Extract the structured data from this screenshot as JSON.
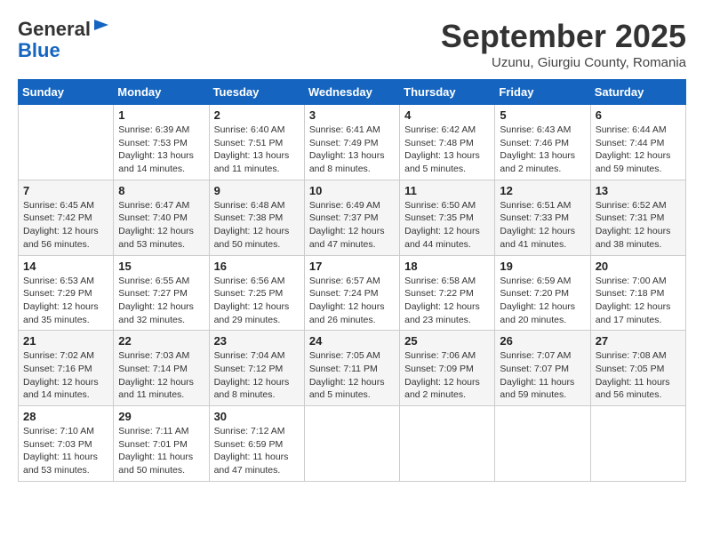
{
  "header": {
    "logo_line1": "General",
    "logo_line2": "Blue",
    "month_title": "September 2025",
    "subtitle": "Uzunu, Giurgiu County, Romania"
  },
  "weekdays": [
    "Sunday",
    "Monday",
    "Tuesday",
    "Wednesday",
    "Thursday",
    "Friday",
    "Saturday"
  ],
  "weeks": [
    [
      {
        "day": "",
        "sunrise": "",
        "sunset": "",
        "daylight": ""
      },
      {
        "day": "1",
        "sunrise": "Sunrise: 6:39 AM",
        "sunset": "Sunset: 7:53 PM",
        "daylight": "Daylight: 13 hours and 14 minutes."
      },
      {
        "day": "2",
        "sunrise": "Sunrise: 6:40 AM",
        "sunset": "Sunset: 7:51 PM",
        "daylight": "Daylight: 13 hours and 11 minutes."
      },
      {
        "day": "3",
        "sunrise": "Sunrise: 6:41 AM",
        "sunset": "Sunset: 7:49 PM",
        "daylight": "Daylight: 13 hours and 8 minutes."
      },
      {
        "day": "4",
        "sunrise": "Sunrise: 6:42 AM",
        "sunset": "Sunset: 7:48 PM",
        "daylight": "Daylight: 13 hours and 5 minutes."
      },
      {
        "day": "5",
        "sunrise": "Sunrise: 6:43 AM",
        "sunset": "Sunset: 7:46 PM",
        "daylight": "Daylight: 13 hours and 2 minutes."
      },
      {
        "day": "6",
        "sunrise": "Sunrise: 6:44 AM",
        "sunset": "Sunset: 7:44 PM",
        "daylight": "Daylight: 12 hours and 59 minutes."
      }
    ],
    [
      {
        "day": "7",
        "sunrise": "Sunrise: 6:45 AM",
        "sunset": "Sunset: 7:42 PM",
        "daylight": "Daylight: 12 hours and 56 minutes."
      },
      {
        "day": "8",
        "sunrise": "Sunrise: 6:47 AM",
        "sunset": "Sunset: 7:40 PM",
        "daylight": "Daylight: 12 hours and 53 minutes."
      },
      {
        "day": "9",
        "sunrise": "Sunrise: 6:48 AM",
        "sunset": "Sunset: 7:38 PM",
        "daylight": "Daylight: 12 hours and 50 minutes."
      },
      {
        "day": "10",
        "sunrise": "Sunrise: 6:49 AM",
        "sunset": "Sunset: 7:37 PM",
        "daylight": "Daylight: 12 hours and 47 minutes."
      },
      {
        "day": "11",
        "sunrise": "Sunrise: 6:50 AM",
        "sunset": "Sunset: 7:35 PM",
        "daylight": "Daylight: 12 hours and 44 minutes."
      },
      {
        "day": "12",
        "sunrise": "Sunrise: 6:51 AM",
        "sunset": "Sunset: 7:33 PM",
        "daylight": "Daylight: 12 hours and 41 minutes."
      },
      {
        "day": "13",
        "sunrise": "Sunrise: 6:52 AM",
        "sunset": "Sunset: 7:31 PM",
        "daylight": "Daylight: 12 hours and 38 minutes."
      }
    ],
    [
      {
        "day": "14",
        "sunrise": "Sunrise: 6:53 AM",
        "sunset": "Sunset: 7:29 PM",
        "daylight": "Daylight: 12 hours and 35 minutes."
      },
      {
        "day": "15",
        "sunrise": "Sunrise: 6:55 AM",
        "sunset": "Sunset: 7:27 PM",
        "daylight": "Daylight: 12 hours and 32 minutes."
      },
      {
        "day": "16",
        "sunrise": "Sunrise: 6:56 AM",
        "sunset": "Sunset: 7:25 PM",
        "daylight": "Daylight: 12 hours and 29 minutes."
      },
      {
        "day": "17",
        "sunrise": "Sunrise: 6:57 AM",
        "sunset": "Sunset: 7:24 PM",
        "daylight": "Daylight: 12 hours and 26 minutes."
      },
      {
        "day": "18",
        "sunrise": "Sunrise: 6:58 AM",
        "sunset": "Sunset: 7:22 PM",
        "daylight": "Daylight: 12 hours and 23 minutes."
      },
      {
        "day": "19",
        "sunrise": "Sunrise: 6:59 AM",
        "sunset": "Sunset: 7:20 PM",
        "daylight": "Daylight: 12 hours and 20 minutes."
      },
      {
        "day": "20",
        "sunrise": "Sunrise: 7:00 AM",
        "sunset": "Sunset: 7:18 PM",
        "daylight": "Daylight: 12 hours and 17 minutes."
      }
    ],
    [
      {
        "day": "21",
        "sunrise": "Sunrise: 7:02 AM",
        "sunset": "Sunset: 7:16 PM",
        "daylight": "Daylight: 12 hours and 14 minutes."
      },
      {
        "day": "22",
        "sunrise": "Sunrise: 7:03 AM",
        "sunset": "Sunset: 7:14 PM",
        "daylight": "Daylight: 12 hours and 11 minutes."
      },
      {
        "day": "23",
        "sunrise": "Sunrise: 7:04 AM",
        "sunset": "Sunset: 7:12 PM",
        "daylight": "Daylight: 12 hours and 8 minutes."
      },
      {
        "day": "24",
        "sunrise": "Sunrise: 7:05 AM",
        "sunset": "Sunset: 7:11 PM",
        "daylight": "Daylight: 12 hours and 5 minutes."
      },
      {
        "day": "25",
        "sunrise": "Sunrise: 7:06 AM",
        "sunset": "Sunset: 7:09 PM",
        "daylight": "Daylight: 12 hours and 2 minutes."
      },
      {
        "day": "26",
        "sunrise": "Sunrise: 7:07 AM",
        "sunset": "Sunset: 7:07 PM",
        "daylight": "Daylight: 11 hours and 59 minutes."
      },
      {
        "day": "27",
        "sunrise": "Sunrise: 7:08 AM",
        "sunset": "Sunset: 7:05 PM",
        "daylight": "Daylight: 11 hours and 56 minutes."
      }
    ],
    [
      {
        "day": "28",
        "sunrise": "Sunrise: 7:10 AM",
        "sunset": "Sunset: 7:03 PM",
        "daylight": "Daylight: 11 hours and 53 minutes."
      },
      {
        "day": "29",
        "sunrise": "Sunrise: 7:11 AM",
        "sunset": "Sunset: 7:01 PM",
        "daylight": "Daylight: 11 hours and 50 minutes."
      },
      {
        "day": "30",
        "sunrise": "Sunrise: 7:12 AM",
        "sunset": "Sunset: 6:59 PM",
        "daylight": "Daylight: 11 hours and 47 minutes."
      },
      {
        "day": "",
        "sunrise": "",
        "sunset": "",
        "daylight": ""
      },
      {
        "day": "",
        "sunrise": "",
        "sunset": "",
        "daylight": ""
      },
      {
        "day": "",
        "sunrise": "",
        "sunset": "",
        "daylight": ""
      },
      {
        "day": "",
        "sunrise": "",
        "sunset": "",
        "daylight": ""
      }
    ]
  ]
}
